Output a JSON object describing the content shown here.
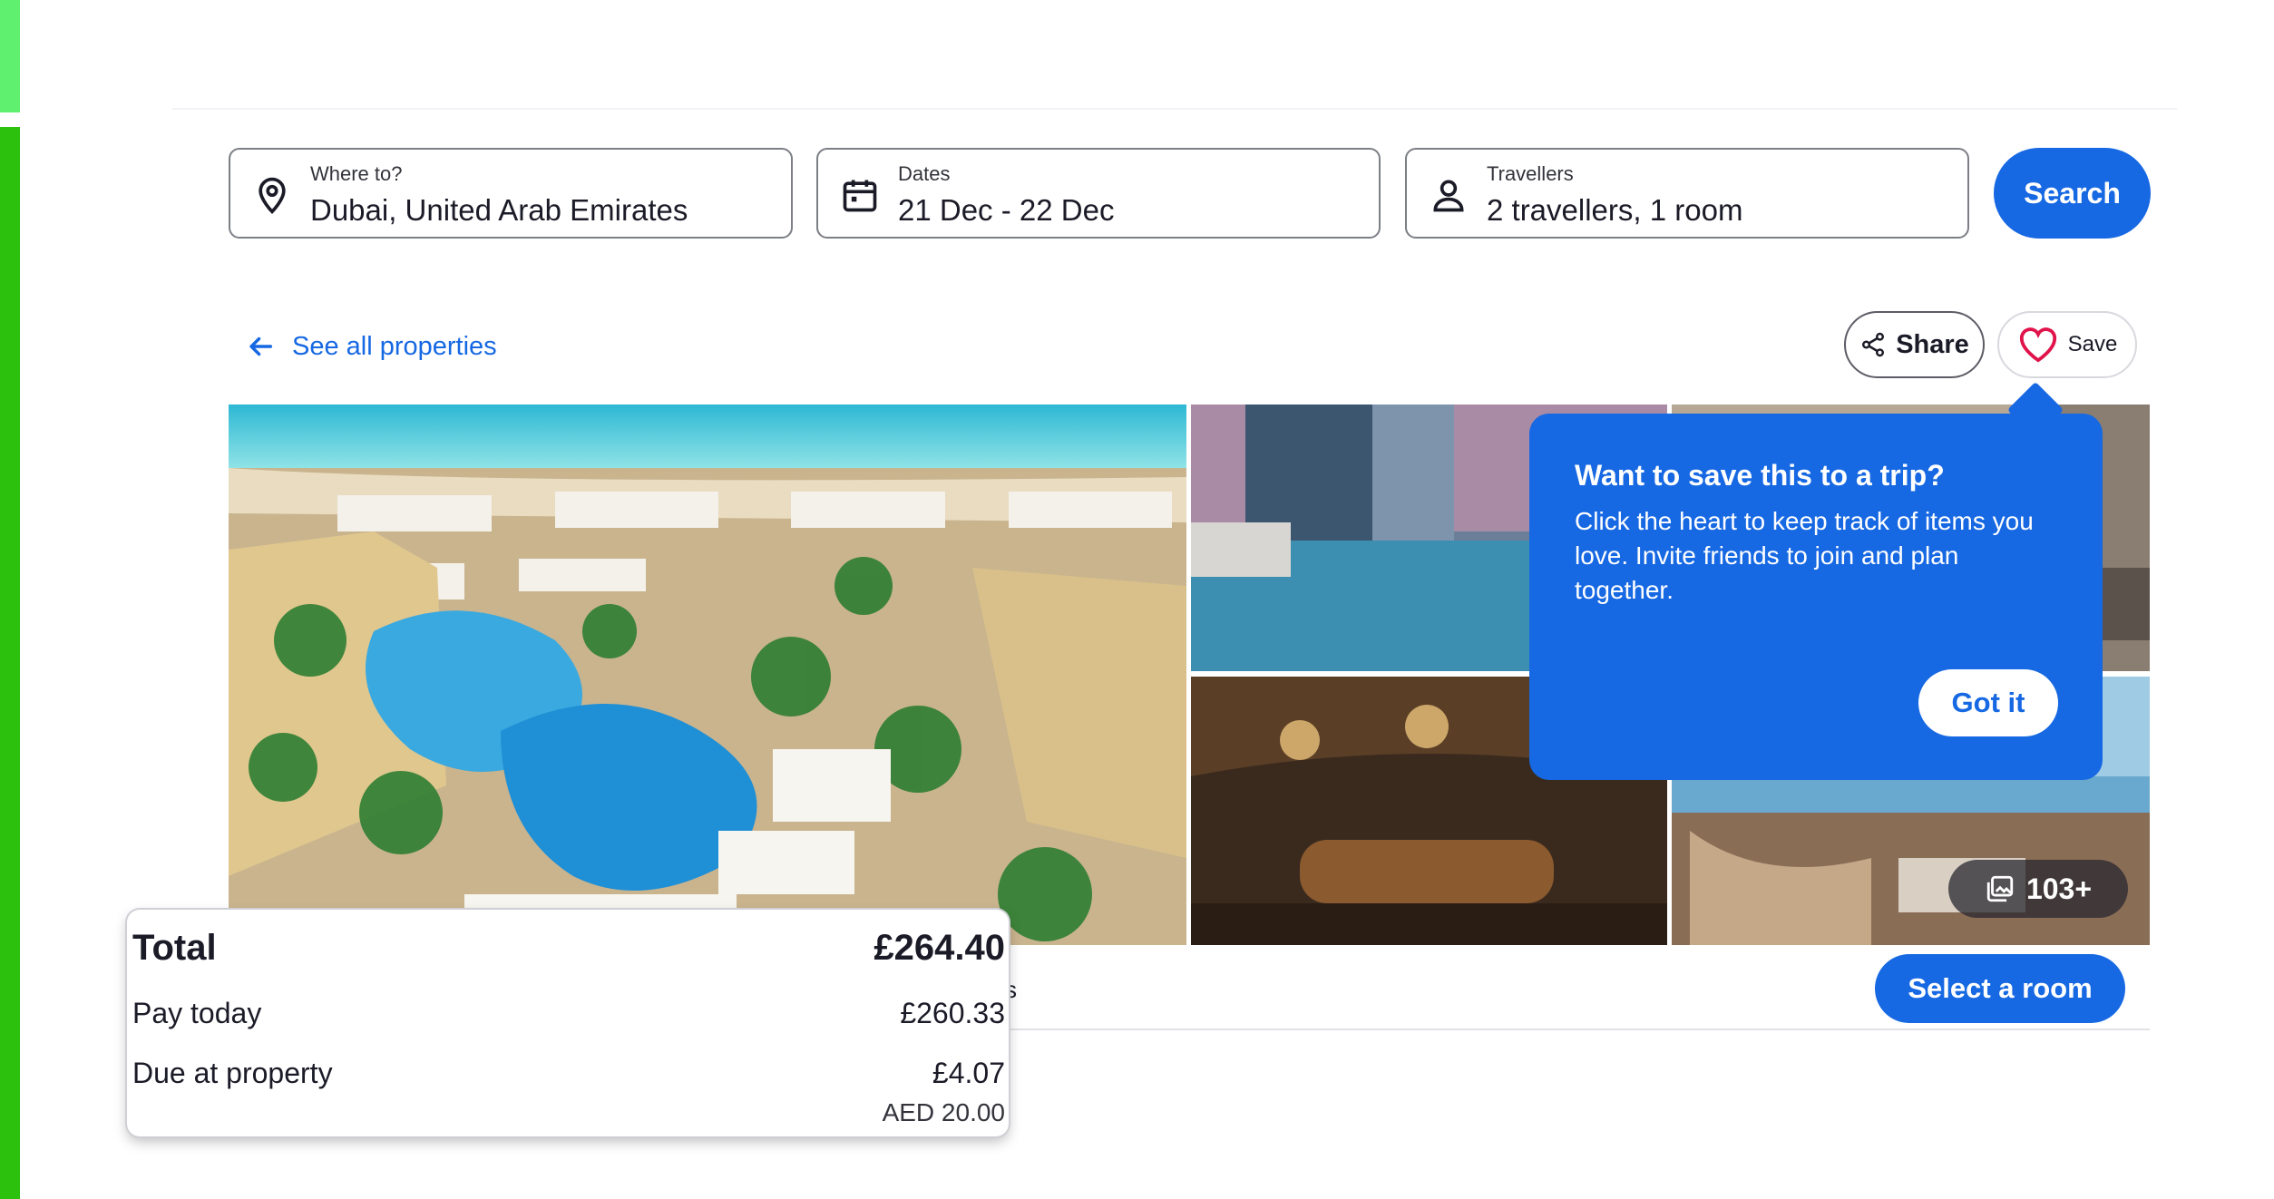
{
  "search": {
    "destination": {
      "label": "Where to?",
      "value": "Dubai, United Arab Emirates",
      "icon": "location-pin-icon"
    },
    "dates": {
      "label": "Dates",
      "value": "21 Dec - 22 Dec",
      "icon": "calendar-icon"
    },
    "travellers": {
      "label": "Travellers",
      "value": "2 travellers, 1 room",
      "icon": "person-icon"
    },
    "button": "Search"
  },
  "nav": {
    "back_link": "See all properties"
  },
  "actions": {
    "share": "Share",
    "save": "Save"
  },
  "gallery": {
    "photo_count": "103+"
  },
  "tooltip": {
    "title": "Want to save this to a trip?",
    "body": "Click the heart to keep track of items you love. Invite friends to join and plan together.",
    "button": "Got it"
  },
  "cta": {
    "select_room": "Select a room"
  },
  "price_summary": {
    "total_label": "Total",
    "total_value": "£264.40",
    "pay_today_label": "Pay today",
    "pay_today_value": "£260.33",
    "due_label": "Due at property",
    "due_value": "£4.07",
    "due_local": "AED 20.00"
  },
  "colors": {
    "accent": "#1668e3",
    "green_bar": "#2cc10c"
  }
}
